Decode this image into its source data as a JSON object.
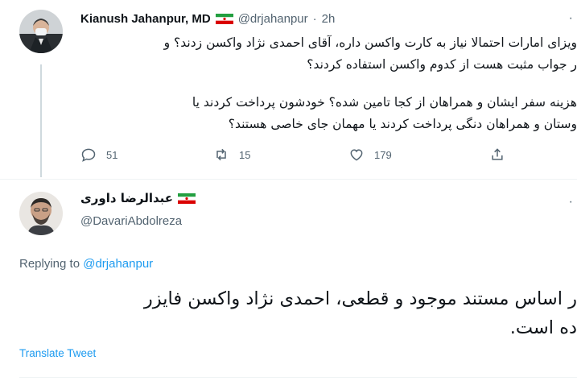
{
  "tweet1": {
    "author_name": "Kianush Jahanpur, MD",
    "handle": "@drjahanpur",
    "separator": "·",
    "time": "2h",
    "text_lines": [
      "ویزای امارات احتمالا نیاز به کارت واکسن داره، آقای احمدی نژاد واکسن زدند؟ و",
      "ر جواب مثبت هست از کدوم واکسن استفاده کردند؟",
      "هزینه سفر ایشان و همراهان از کجا تامین شده؟ خودشون پرداخت کردند یا",
      "وستان و همراهان دنگی پرداخت کردند یا مهمان جای خاصی هستند؟"
    ],
    "actions": {
      "reply_count": "51",
      "retweet_count": "15",
      "like_count": "179"
    }
  },
  "tweet2": {
    "author_name": "عبدالرضا داوری",
    "handle": "@DavariAbdolreza",
    "replying_prefix": "Replying to",
    "replying_to": "@drjahanpur",
    "text_lines": [
      "ر اساس مستند موجود و قطعی، احمدی نژاد واکسن فایزر",
      "ده است."
    ],
    "translate_label": "Translate Tweet"
  },
  "colors": {
    "link": "#1d9bf0",
    "secondary_text": "#536471",
    "primary_text": "#0f1419",
    "thread_line": "#cfd9de"
  }
}
